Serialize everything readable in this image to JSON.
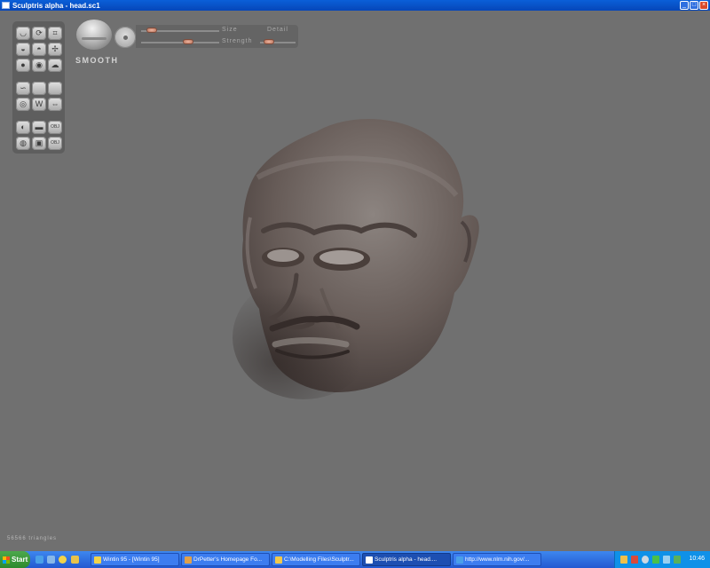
{
  "window": {
    "title": "Sculptris alpha - head.sc1",
    "minimize_glyph": "_",
    "maximize_glyph": "□",
    "close_glyph": "×"
  },
  "toolbar": {
    "tools": [
      {
        "name": "draw-tool",
        "glyph": "◡"
      },
      {
        "name": "rotate-tool",
        "glyph": "⟳"
      },
      {
        "name": "crop-tool",
        "glyph": "⌗"
      },
      {
        "name": "inflate-tool",
        "glyph": "◒"
      },
      {
        "name": "pinch-tool",
        "glyph": "◓"
      },
      {
        "name": "grab-tool",
        "glyph": "✢"
      },
      {
        "name": "flatten-tool",
        "glyph": "●"
      },
      {
        "name": "smooth-tool",
        "glyph": "◉"
      },
      {
        "name": "reduce-tool",
        "glyph": "☁"
      },
      {
        "name": "curve-tool",
        "glyph": "∽"
      },
      {
        "name": "blank-tool-a",
        "glyph": ""
      },
      {
        "name": "blank-tool-b",
        "glyph": ""
      },
      {
        "name": "sphere-tool",
        "glyph": "◎"
      },
      {
        "name": "wave-tool",
        "glyph": "W"
      },
      {
        "name": "symmetry-tool",
        "glyph": "⇔"
      },
      {
        "name": "material-tool",
        "glyph": "◐"
      },
      {
        "name": "plane-tool",
        "glyph": "▬"
      },
      {
        "name": "obj-export-tool",
        "glyph": "OBJ"
      },
      {
        "name": "wireframe-tool",
        "glyph": "◍"
      },
      {
        "name": "save-tool",
        "glyph": "▣"
      },
      {
        "name": "obj-import-tool",
        "glyph": "OBJ"
      }
    ]
  },
  "brush": {
    "mode": "SMOOTH",
    "size_label": "Size",
    "detail_label": "Detail",
    "strength_label": "Strength",
    "size_value": 0.08,
    "strength_value": 0.62,
    "detail_value": 0.15
  },
  "status": {
    "triangles": "56566 triangles"
  },
  "taskbar": {
    "start_label": "Start",
    "tasks": [
      {
        "label": "Wintin 95 - [Wintin 95]",
        "active": false,
        "color": "#f2d34a"
      },
      {
        "label": "DrPetter's Homepage Fo...",
        "active": false,
        "color": "#e0a04a"
      },
      {
        "label": "C:\\Modelling Files\\Sculptr...",
        "active": false,
        "color": "#f0c84c"
      },
      {
        "label": "Sculptris alpha - head....",
        "active": true,
        "color": "#ffffff"
      },
      {
        "label": "http://www.nlm.nih.gov/...",
        "active": false,
        "color": "#4aa0e8"
      }
    ],
    "clock": "10:46"
  },
  "colors": {
    "viewport": "#707070",
    "palette": "#5e5e5e",
    "knob": "#c17a62",
    "titlebar": "#0a5fd8"
  }
}
